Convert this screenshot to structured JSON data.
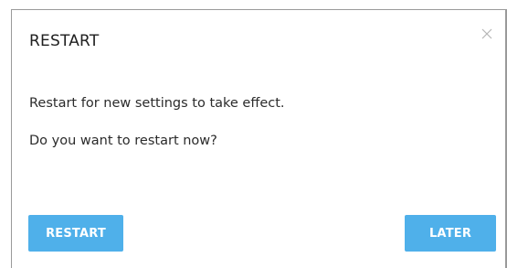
{
  "dialog": {
    "title": "RESTART",
    "close_icon": "close-icon",
    "message_line1": "Restart for new settings to take effect.",
    "message_line2": "Do you want to restart now?",
    "restart_label": "RESTART",
    "later_label": "LATER"
  },
  "colors": {
    "accent": "#4fb0ea",
    "text": "#2b2b2b",
    "border": "#9a9a9a"
  }
}
